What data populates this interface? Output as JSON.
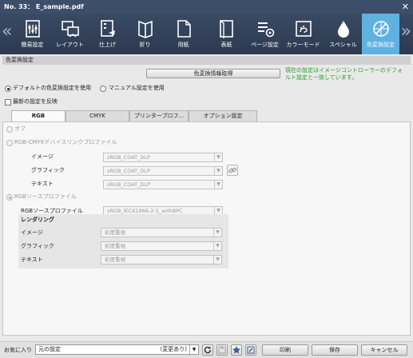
{
  "window": {
    "title": "No. 33： E_sample.pdf",
    "close_glyph": "✕"
  },
  "ribbon": {
    "tabs": [
      {
        "label": "簡易設定",
        "icon": "simple-setting-icon"
      },
      {
        "label": "レイアウト",
        "icon": "layout-icon"
      },
      {
        "label": "仕上げ",
        "icon": "finishing-icon"
      },
      {
        "label": "折り",
        "icon": "fold-icon"
      },
      {
        "label": "用紙",
        "icon": "paper-icon"
      },
      {
        "label": "表紙",
        "icon": "cover-icon"
      },
      {
        "label": "ページ設定",
        "icon": "page-setting-icon"
      },
      {
        "label": "カラーモード",
        "icon": "color-mode-icon"
      },
      {
        "label": "スペシャル",
        "icon": "special-icon"
      },
      {
        "label": "色変換設定",
        "icon": "color-conversion-icon",
        "active": true
      }
    ],
    "scroll_left": "«",
    "scroll_right": "»",
    "active_color": "#5fb1e0"
  },
  "section": {
    "title": "色変換設定"
  },
  "get_info_button": "色変換情報取得",
  "note": "現在の設定はイメージコントローラーのデフォルト設定と一致しています。",
  "mode": {
    "default_label": "デフォルトの色変換設定を使用",
    "manual_label": "マニュアル設定を使用",
    "selected": "default"
  },
  "reflect_latest": "最新の設定を反映",
  "tabs": [
    "RGB",
    "CMYK",
    "プリンタープロフ...",
    "オプション設定"
  ],
  "rgb": {
    "off_label": "オフ",
    "devicelink_label": "RGB-CMYKデバイスリンクプロファイル",
    "devicelink_rows": [
      {
        "label": "イメージ",
        "value": "sRGB_COAT_DLP"
      },
      {
        "label": "グラフィック",
        "value": "sRGB_COAT_DLP"
      },
      {
        "label": "テキスト",
        "value": "sRGB_COAT_DLP"
      }
    ],
    "source_label": "RGBソースプロファイル",
    "source_profile_label": "RGBソースプロファイル",
    "source_profile_value": "sRGB_IEC61966-2-1_withBPC",
    "rendering_label": "レンダリング",
    "rendering_rows": [
      {
        "label": "イメージ",
        "value": "彩度重視"
      },
      {
        "label": "グラフィック",
        "value": "彩度重視"
      },
      {
        "label": "テキスト",
        "value": "彩度重視"
      }
    ]
  },
  "footer": {
    "favorites_label": "お気に入り",
    "favorites_value": "元の設定",
    "favorites_changed": "(変更あり)",
    "print_button": "印刷",
    "save_button": "保存",
    "cancel_button": "キャンセル"
  }
}
